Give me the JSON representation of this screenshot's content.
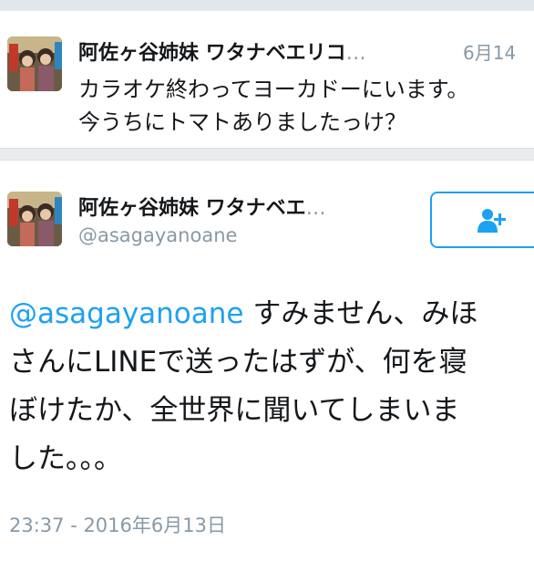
{
  "tweet1": {
    "display_name": "阿佐ヶ谷姉妹 ワタナベエリコ",
    "ellipsis": "…",
    "date": "6月14",
    "text_lines": [
      "カラオケ終わってヨーカドーにいます。",
      "今うちにトマトありましたっけ？"
    ],
    "avatar_icon": "profile-photo"
  },
  "tweet2": {
    "display_name": "阿佐ヶ谷姉妹 ワタナベエ",
    "ellipsis": "…",
    "handle": "@asagayanoane",
    "follow_icon": "add-user-icon",
    "mention": "@asagayanoane",
    "body_line1_rest": " すみません、みほ",
    "body_lines": [
      "さんにLINEで送ったはずが、何を寝",
      "ぼけたか、全世界に聞いてしまいま",
      "した。。。"
    ],
    "timestamp": "23:37 - 2016年6月13日"
  },
  "colors": {
    "accent": "#1da1f2",
    "muted": "#8899a6",
    "text": "#14171a",
    "separator": "#e8ecef"
  }
}
